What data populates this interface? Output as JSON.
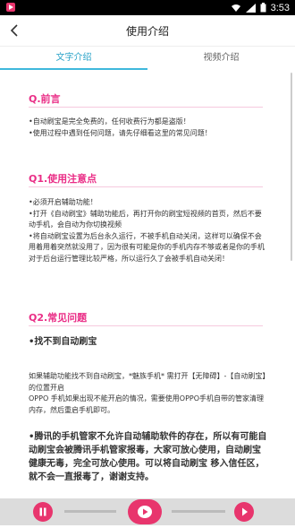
{
  "status_bar": {
    "time": "3:53"
  },
  "header": {
    "title": "使用介绍"
  },
  "tabs": [
    {
      "label": "文字介绍",
      "active": true
    },
    {
      "label": "视频介绍",
      "active": false
    }
  ],
  "sections": {
    "preface": {
      "title": "Q.前言",
      "lines": [
        "•自动刷宝是完全免费的，任何收费行为都是盗版！",
        "•使用过程中遇到任何问题，请先仔细看这里的常见问题！"
      ]
    },
    "notes": {
      "title": "Q1.使用注意点",
      "lines": [
        "•必须开启辅助功能！",
        "•打开《自动刷宝》辅助功能后，再打开你的刷宝短视频的首页，然后不要动手机，会自动为你切换视频",
        "•将自动刷宝设置为后台永久运行，不被手机自动关闭，这样可以确保不会用着用着突然就没用了，因为很有可能是你的手机内存不够或者是你的手机对于后台运行管理比较严格，所以运行久了会被手机自动关闭！"
      ]
    },
    "faq": {
      "title": "Q2.常见问题",
      "item_title": "•找不到自动刷宝",
      "lines": [
        "如果辅助功能找不到自动刷宝，*魅族手机* 需打开【无障碍】-【自动刷宝】的位置开启",
        "OPPO 手机如果出现不能开启的情况，需要使用OPPO手机自带的管家清理内存，然后重启手机即可。"
      ],
      "bold_note": "•腾讯的手机管家不允许自动辅助软件的存在，所以有可能自动刷宝会被腾讯手机管家报毒，大家可放心使用，自动刷宝健康无毒，完全可放心使用。可以将自动刷宝 移入信任区，就不会一直报毒了，谢谢支持。"
    }
  },
  "colors": {
    "accent": "#2aa3c8",
    "section_title": "#ea2d86",
    "control": "#e8356d"
  }
}
